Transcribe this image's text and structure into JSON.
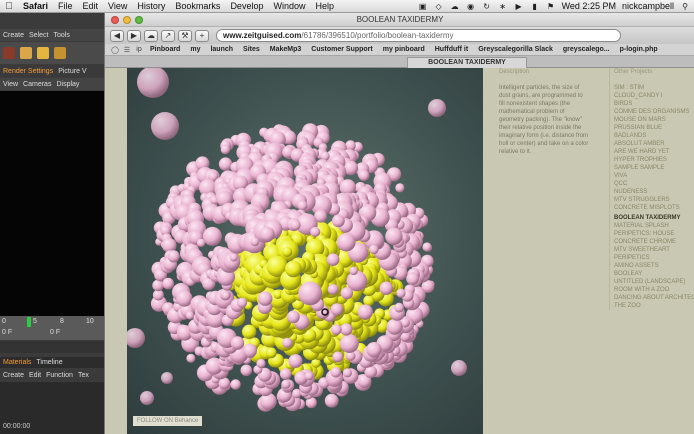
{
  "menubar": {
    "app": "Safari",
    "menus": [
      "File",
      "Edit",
      "View",
      "History",
      "Bookmarks",
      "Develop",
      "Window",
      "Help"
    ],
    "datetime": "Wed 2:25 PM",
    "user": "nickcampbell"
  },
  "c4d": {
    "row1": [
      "Create",
      "Select",
      "Tools"
    ],
    "row3": [
      "Render Settings",
      "Picture V"
    ],
    "row4": [
      "View",
      "Cameras",
      "Display"
    ],
    "timeline_labels": [
      "0",
      "5",
      "8",
      "10"
    ],
    "frame_a": "0 F",
    "frame_b": "0 F",
    "tabs": [
      "Materials",
      "Timeline"
    ],
    "row7": [
      "Create",
      "Edit",
      "Function",
      "Tex"
    ],
    "timecode": "00:00:00"
  },
  "window": {
    "title": "BOOLEAN TAXIDERMY",
    "url_domain": "www.zeitguised.com",
    "url_path": "/61786/396510/portfolio/boolean-taxidermy",
    "bookmarks": [
      "Pinboard",
      "my",
      "launch",
      "Sites",
      "MakeMp3",
      "Customer Support",
      "my pinboard",
      "Huffduff it",
      "Greyscalegorilla Slack",
      "greyscalego...",
      "p-login.php"
    ],
    "tab_title": "BOOLEAN TAXIDERMY"
  },
  "page": {
    "follow_label": "FOLLOW ON Behance",
    "description_heading": "Description",
    "description": "Intelligent particles, the size of dust grains, are programmed to fill nonexistent shapes (the mathematical problem of geometry packing). The \"know\" their relative position inside the imaginary form (i.e. distance from hull or center) and take on a color relative to it.",
    "projects_heading": "Other Projects",
    "projects": [
      "SIM : STIM",
      "CLOUD_CANDY I",
      "BIRDS",
      "COMME DES ORGANISMS",
      "MOUSE ON MARS",
      "PRUSSIAN BLUE",
      "BADLANDS",
      "ABSOLUT AMBER",
      "ARE WE HARD YET",
      "HYPER TROPHIES",
      "SAMPLE SAMPLE",
      "VIVA",
      "QCC",
      "NUDENESS",
      "MTV STRUGGLERS",
      "CONCRETE MISPLOTS",
      "BOOLEAN TAXIDERMY",
      "MATERIAL SPLASH",
      "PERIPETICS: HOUSE",
      "CONCRETE CHROME",
      "MTV SWEETHEART",
      "PERIPETICS",
      "AMINO ASSETS",
      "BOOLEAY",
      "UNTITLED (LANDSCAPE)",
      "ROOM WITH A ZOO",
      "DANCING ABOUT ARCHITECTURE",
      "THE ZOO"
    ],
    "active_project": "BOOLEAN TAXIDERMY"
  },
  "colors": {
    "page_bg": "#c9c8b3",
    "sphere_pink": "#e9b3d0",
    "sphere_yellow": "#e6e619",
    "art_bg": "#4a5e5a"
  }
}
